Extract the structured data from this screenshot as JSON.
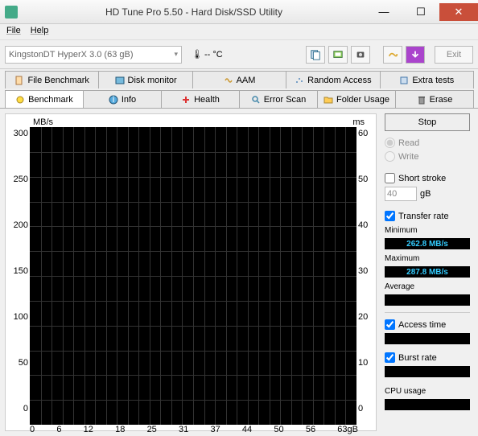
{
  "window": {
    "title": "HD Tune Pro 5.50 - Hard Disk/SSD Utility"
  },
  "menu": {
    "file": "File",
    "help": "Help"
  },
  "toolbar": {
    "device": "KingstonDT HyperX 3.0 (63 gB)",
    "temp": "-- °C",
    "exit": "Exit"
  },
  "tabs_top": [
    {
      "label": "File Benchmark"
    },
    {
      "label": "Disk monitor"
    },
    {
      "label": "AAM"
    },
    {
      "label": "Random Access"
    },
    {
      "label": "Extra tests"
    }
  ],
  "tabs_bottom": [
    {
      "label": "Benchmark"
    },
    {
      "label": "Info"
    },
    {
      "label": "Health"
    },
    {
      "label": "Error Scan"
    },
    {
      "label": "Folder Usage"
    },
    {
      "label": "Erase"
    }
  ],
  "chart_data": {
    "type": "line",
    "title": "",
    "y_left_label": "MB/s",
    "y_right_label": "ms",
    "y_left_ticks": [
      "300",
      "250",
      "200",
      "150",
      "100",
      "50",
      "0"
    ],
    "y_right_ticks": [
      "60",
      "50",
      "40",
      "30",
      "20",
      "10",
      "0"
    ],
    "x_ticks": [
      "0",
      "6",
      "12",
      "18",
      "25",
      "31",
      "37",
      "44",
      "50",
      "56",
      "63gB"
    ],
    "x_unit": "gB",
    "series": [
      {
        "name": "Transfer rate",
        "values": []
      },
      {
        "name": "Access time",
        "values": []
      }
    ],
    "xlim": [
      0,
      63
    ],
    "ylim_left": [
      0,
      300
    ],
    "ylim_right": [
      0,
      60
    ]
  },
  "controls": {
    "stop": "Stop",
    "read": "Read",
    "write": "Write",
    "short_stroke": "Short stroke",
    "short_stroke_val": "40",
    "short_stroke_unit": "gB",
    "transfer_rate": "Transfer rate",
    "minimum_label": "Minimum",
    "minimum_value": "262.8 MB/s",
    "maximum_label": "Maximum",
    "maximum_value": "287.8 MB/s",
    "average_label": "Average",
    "average_value": "",
    "access_time": "Access time",
    "access_time_value": "",
    "burst_rate": "Burst rate",
    "burst_rate_value": "",
    "cpu_usage": "CPU usage",
    "cpu_usage_value": ""
  }
}
